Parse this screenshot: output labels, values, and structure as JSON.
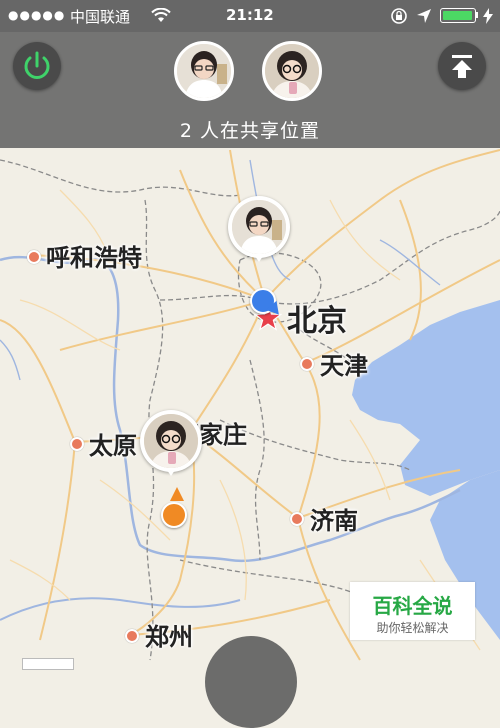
{
  "status_bar": {
    "signal": "●●●●●",
    "carrier": "中国联通",
    "time": "21:12"
  },
  "header": {
    "sharing_text": "2 人在共享位置"
  },
  "map": {
    "cities": [
      {
        "name": "呼和浩特"
      },
      {
        "name": "北京"
      },
      {
        "name": "天津"
      },
      {
        "name": "太原"
      },
      {
        "name": "石家庄"
      },
      {
        "name": "济南"
      },
      {
        "name": "郑州"
      }
    ]
  },
  "watermark": {
    "title": "百科全说",
    "subtitle": "助你轻松解决"
  },
  "colors": {
    "power_green": "#3fd36a",
    "beijing_star": "#e8404b",
    "user_blue": "#3b7ee8",
    "user_orange": "#f08a24",
    "sea": "#9fbcec",
    "battery": "#4cd964"
  }
}
